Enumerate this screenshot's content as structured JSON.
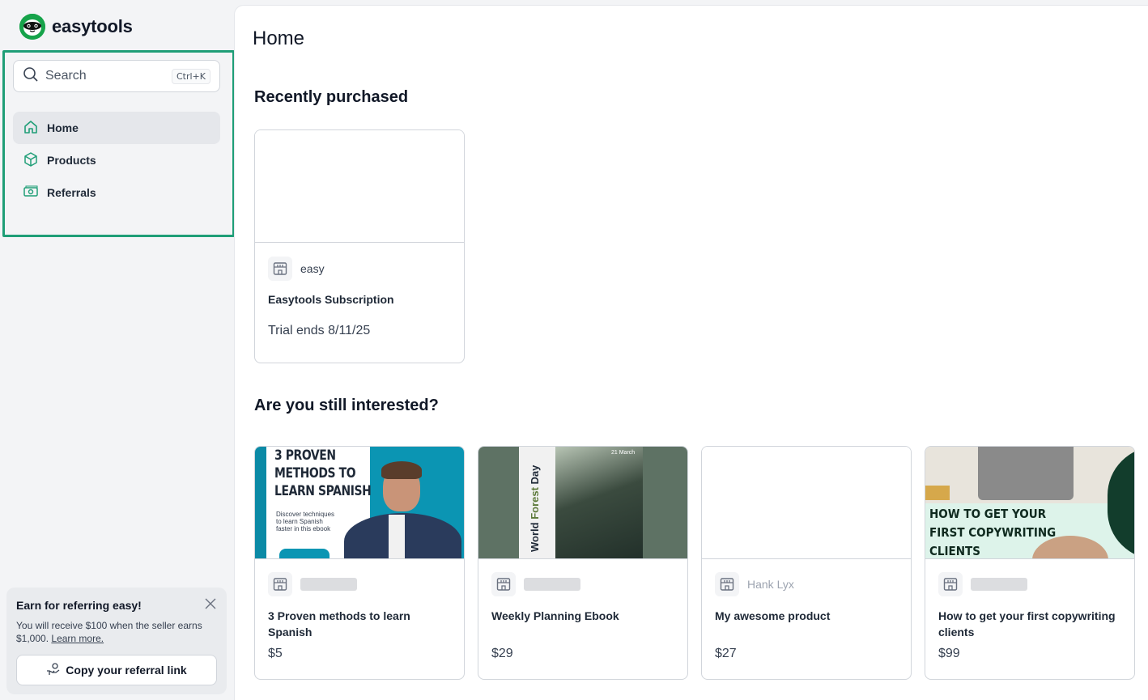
{
  "app": {
    "name": "easytools"
  },
  "sidebar": {
    "search": {
      "placeholder": "Search",
      "shortcut": "Ctrl+K"
    },
    "items": [
      {
        "label": "Home",
        "icon": "home-icon",
        "active": true
      },
      {
        "label": "Products",
        "icon": "box-icon",
        "active": false
      },
      {
        "label": "Referrals",
        "icon": "money-icon",
        "active": false
      }
    ],
    "promo": {
      "title": "Earn for referring easy!",
      "text": "You will receive $100 when the seller earns $1,000.",
      "link": "Learn more.",
      "button": "Copy your referral link"
    }
  },
  "main": {
    "title": "Home",
    "recent": {
      "heading": "Recently purchased",
      "items": [
        {
          "seller": "easy",
          "name": "Easytools Subscription",
          "status": "Trial ends 8/11/25"
        }
      ]
    },
    "interested": {
      "heading": "Are you still interested?",
      "items": [
        {
          "name": "3 Proven methods to learn Spanish",
          "price": "$5",
          "seller": "",
          "image_text": {
            "title_lines": [
              "3 PROVEN",
              "METHODS TO",
              "LEARN SPANISH"
            ],
            "sub_lines": [
              "Discover techniques",
              "to learn Spanish",
              "faster in this ebook"
            ]
          }
        },
        {
          "name": "Weekly Planning Ebook",
          "price": "$29",
          "seller": "",
          "image_text": {
            "title_a": "World ",
            "title_b": "Forest",
            "title_c": " Day",
            "date": "21 March"
          }
        },
        {
          "name": "My awesome product",
          "price": "$27",
          "seller": "Hank Lyx"
        },
        {
          "name": "How to get your first copywriting clients",
          "price": "$99",
          "seller": "",
          "image_text": {
            "title_lines": [
              "HOW TO GET YOUR",
              "FIRST COPYWRITING",
              "CLIENTS"
            ]
          }
        }
      ]
    }
  },
  "colors": {
    "accent": "#1f9e77",
    "brand": "#16a34a"
  }
}
